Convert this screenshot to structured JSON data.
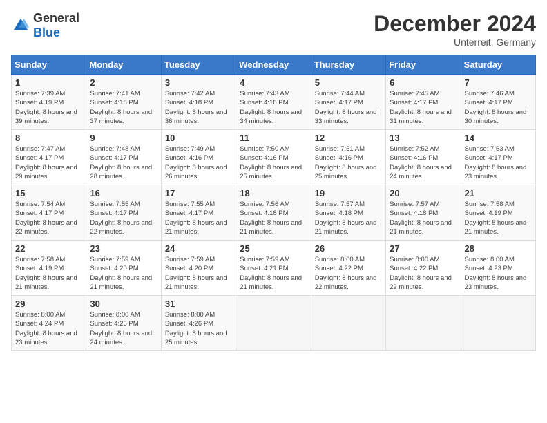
{
  "header": {
    "logo_general": "General",
    "logo_blue": "Blue",
    "month": "December 2024",
    "location": "Unterreit, Germany"
  },
  "days_of_week": [
    "Sunday",
    "Monday",
    "Tuesday",
    "Wednesday",
    "Thursday",
    "Friday",
    "Saturday"
  ],
  "weeks": [
    [
      {
        "day": "1",
        "sunrise": "7:39 AM",
        "sunset": "4:19 PM",
        "daylight": "8 hours and 39 minutes."
      },
      {
        "day": "2",
        "sunrise": "7:41 AM",
        "sunset": "4:18 PM",
        "daylight": "8 hours and 37 minutes."
      },
      {
        "day": "3",
        "sunrise": "7:42 AM",
        "sunset": "4:18 PM",
        "daylight": "8 hours and 36 minutes."
      },
      {
        "day": "4",
        "sunrise": "7:43 AM",
        "sunset": "4:18 PM",
        "daylight": "8 hours and 34 minutes."
      },
      {
        "day": "5",
        "sunrise": "7:44 AM",
        "sunset": "4:17 PM",
        "daylight": "8 hours and 33 minutes."
      },
      {
        "day": "6",
        "sunrise": "7:45 AM",
        "sunset": "4:17 PM",
        "daylight": "8 hours and 31 minutes."
      },
      {
        "day": "7",
        "sunrise": "7:46 AM",
        "sunset": "4:17 PM",
        "daylight": "8 hours and 30 minutes."
      }
    ],
    [
      {
        "day": "8",
        "sunrise": "7:47 AM",
        "sunset": "4:17 PM",
        "daylight": "8 hours and 29 minutes."
      },
      {
        "day": "9",
        "sunrise": "7:48 AM",
        "sunset": "4:17 PM",
        "daylight": "8 hours and 28 minutes."
      },
      {
        "day": "10",
        "sunrise": "7:49 AM",
        "sunset": "4:16 PM",
        "daylight": "8 hours and 26 minutes."
      },
      {
        "day": "11",
        "sunrise": "7:50 AM",
        "sunset": "4:16 PM",
        "daylight": "8 hours and 25 minutes."
      },
      {
        "day": "12",
        "sunrise": "7:51 AM",
        "sunset": "4:16 PM",
        "daylight": "8 hours and 25 minutes."
      },
      {
        "day": "13",
        "sunrise": "7:52 AM",
        "sunset": "4:16 PM",
        "daylight": "8 hours and 24 minutes."
      },
      {
        "day": "14",
        "sunrise": "7:53 AM",
        "sunset": "4:17 PM",
        "daylight": "8 hours and 23 minutes."
      }
    ],
    [
      {
        "day": "15",
        "sunrise": "7:54 AM",
        "sunset": "4:17 PM",
        "daylight": "8 hours and 22 minutes."
      },
      {
        "day": "16",
        "sunrise": "7:55 AM",
        "sunset": "4:17 PM",
        "daylight": "8 hours and 22 minutes."
      },
      {
        "day": "17",
        "sunrise": "7:55 AM",
        "sunset": "4:17 PM",
        "daylight": "8 hours and 21 minutes."
      },
      {
        "day": "18",
        "sunrise": "7:56 AM",
        "sunset": "4:18 PM",
        "daylight": "8 hours and 21 minutes."
      },
      {
        "day": "19",
        "sunrise": "7:57 AM",
        "sunset": "4:18 PM",
        "daylight": "8 hours and 21 minutes."
      },
      {
        "day": "20",
        "sunrise": "7:57 AM",
        "sunset": "4:18 PM",
        "daylight": "8 hours and 21 minutes."
      },
      {
        "day": "21",
        "sunrise": "7:58 AM",
        "sunset": "4:19 PM",
        "daylight": "8 hours and 21 minutes."
      }
    ],
    [
      {
        "day": "22",
        "sunrise": "7:58 AM",
        "sunset": "4:19 PM",
        "daylight": "8 hours and 21 minutes."
      },
      {
        "day": "23",
        "sunrise": "7:59 AM",
        "sunset": "4:20 PM",
        "daylight": "8 hours and 21 minutes."
      },
      {
        "day": "24",
        "sunrise": "7:59 AM",
        "sunset": "4:20 PM",
        "daylight": "8 hours and 21 minutes."
      },
      {
        "day": "25",
        "sunrise": "7:59 AM",
        "sunset": "4:21 PM",
        "daylight": "8 hours and 21 minutes."
      },
      {
        "day": "26",
        "sunrise": "8:00 AM",
        "sunset": "4:22 PM",
        "daylight": "8 hours and 22 minutes."
      },
      {
        "day": "27",
        "sunrise": "8:00 AM",
        "sunset": "4:22 PM",
        "daylight": "8 hours and 22 minutes."
      },
      {
        "day": "28",
        "sunrise": "8:00 AM",
        "sunset": "4:23 PM",
        "daylight": "8 hours and 23 minutes."
      }
    ],
    [
      {
        "day": "29",
        "sunrise": "8:00 AM",
        "sunset": "4:24 PM",
        "daylight": "8 hours and 23 minutes."
      },
      {
        "day": "30",
        "sunrise": "8:00 AM",
        "sunset": "4:25 PM",
        "daylight": "8 hours and 24 minutes."
      },
      {
        "day": "31",
        "sunrise": "8:00 AM",
        "sunset": "4:26 PM",
        "daylight": "8 hours and 25 minutes."
      },
      null,
      null,
      null,
      null
    ]
  ],
  "labels": {
    "sunrise": "Sunrise:",
    "sunset": "Sunset:",
    "daylight": "Daylight:"
  }
}
